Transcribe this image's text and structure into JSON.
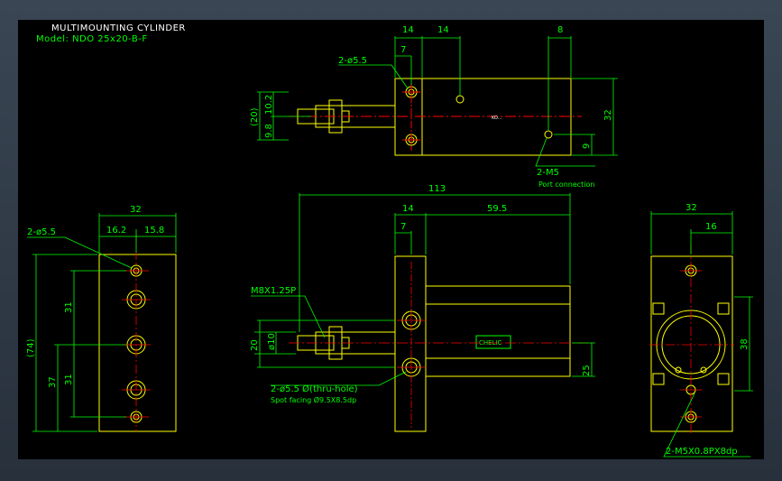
{
  "title": "MULTIMOUNTING CYLINDER",
  "model": "Model: NDO 25x20-B-F",
  "top_view": {
    "dims": [
      "14",
      "14",
      "8",
      "7",
      "10.2",
      "9.8",
      "(20)",
      "32",
      "9"
    ],
    "callouts": [
      "2-ø5.5",
      "2-M5",
      "Port connection"
    ],
    "body_marker": "KO..."
  },
  "left_view": {
    "dims": [
      "32",
      "16.2",
      "15.8",
      "(74)",
      "31",
      "31",
      "37"
    ],
    "callouts": [
      "2-ø5.5"
    ]
  },
  "front_view": {
    "dims": [
      "113",
      "14",
      "59.5",
      "7",
      "20",
      "ø10",
      "25"
    ],
    "callouts": [
      "M8X1.25P",
      "2-ø5.5 Ø(thru-hole)",
      "Spot facing  Ø9.5X8.5dp"
    ],
    "brand": "CHELIC"
  },
  "right_view": {
    "dims": [
      "32",
      "16",
      "38"
    ],
    "callouts": [
      "2-M5X0.8PX8dp"
    ]
  },
  "colors": {
    "background": "#000000",
    "outline": "#ffff00",
    "dimension": "#00ff00",
    "centerline": "#ff0000",
    "text": "#ffffff"
  }
}
